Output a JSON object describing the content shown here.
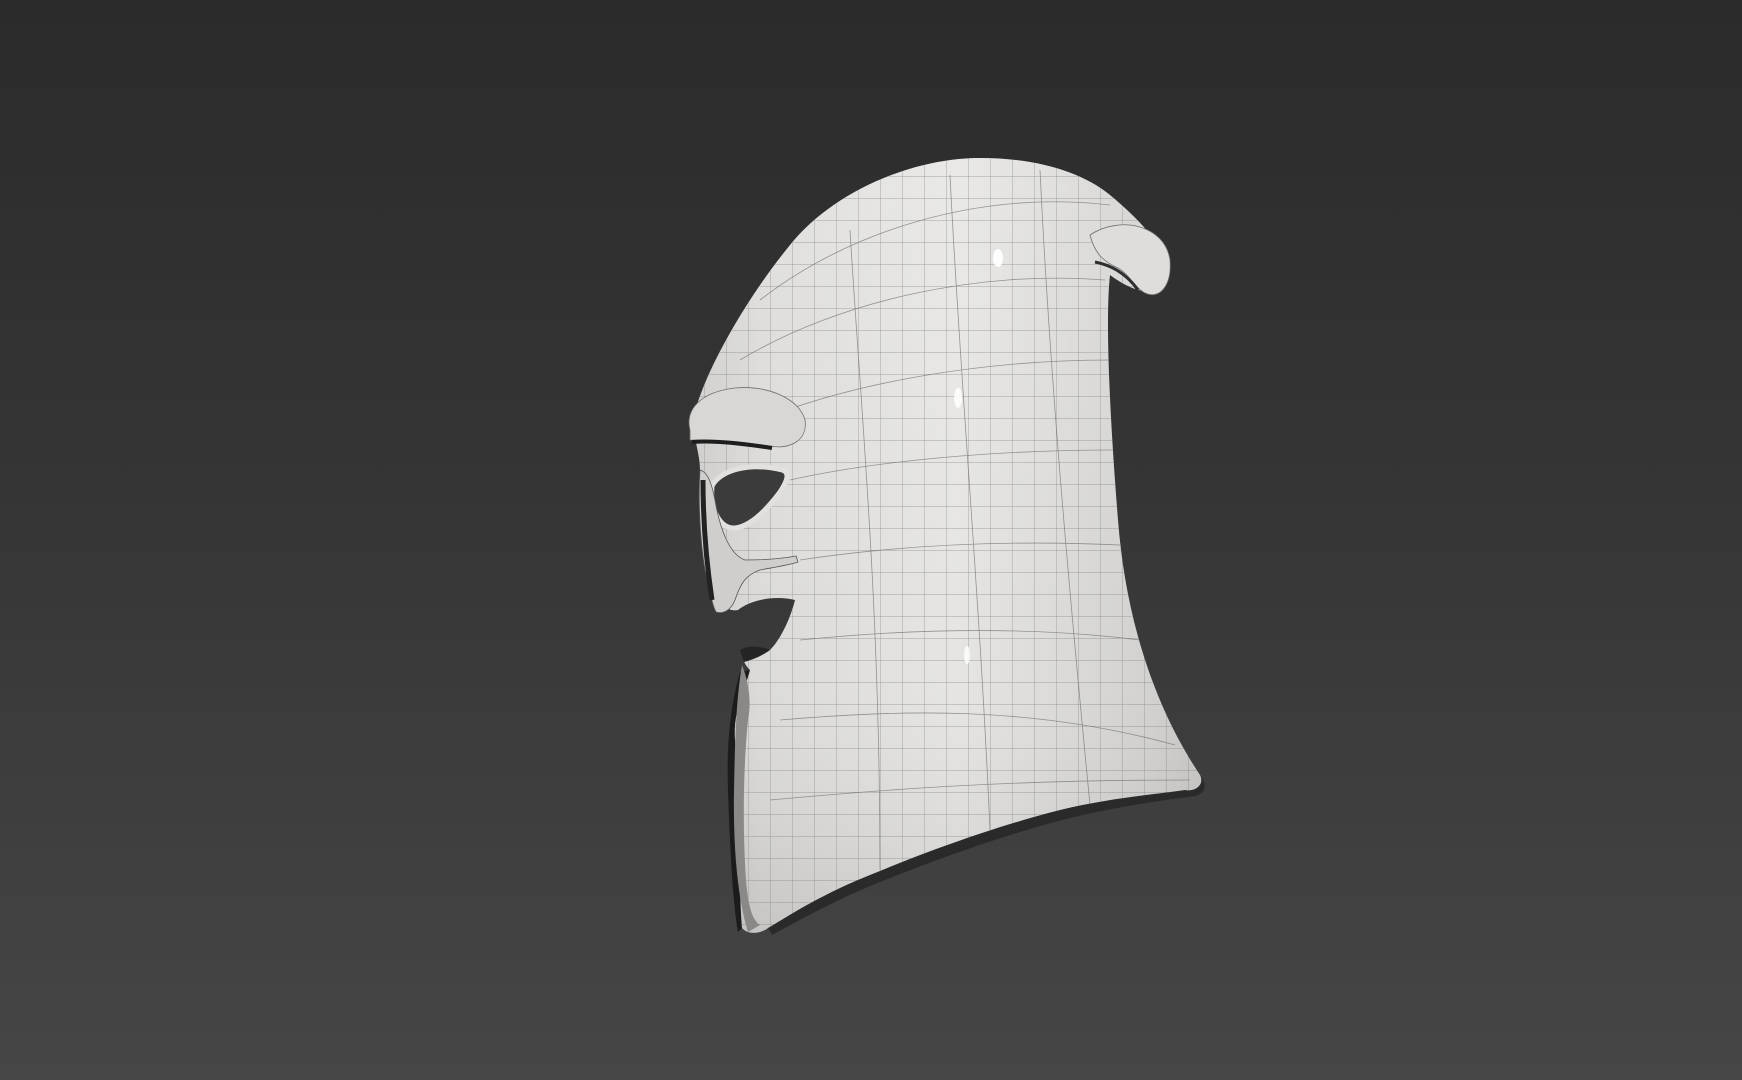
{
  "viewport": {
    "background_top": "#2b2b2b",
    "background_bottom": "#464646"
  },
  "model": {
    "object": "helmet-wireframe-mesh",
    "surface_color": "#dcdbd9",
    "wire_color": "#6e6e6e",
    "shadow_color": "#1c1c1c"
  }
}
